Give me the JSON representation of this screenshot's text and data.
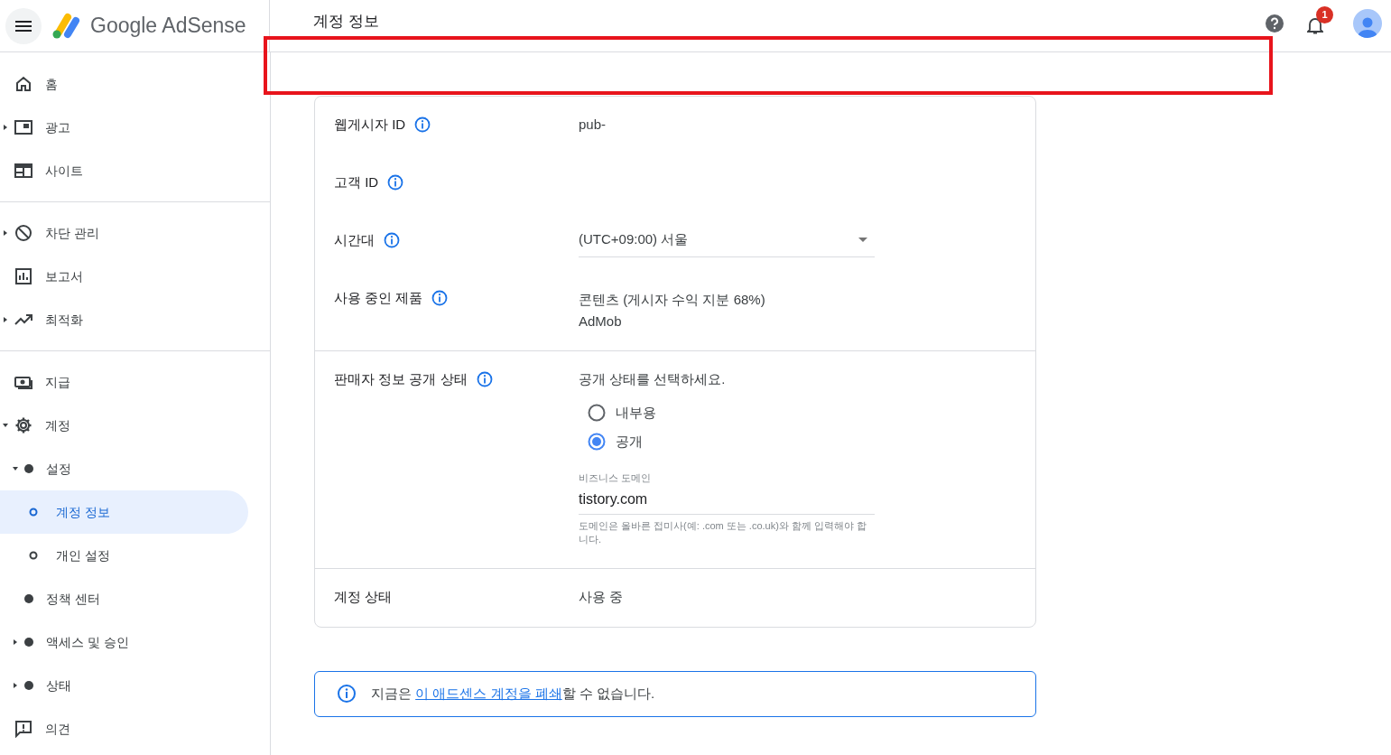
{
  "header": {
    "brand": "Google AdSense",
    "page_title": "계정 정보",
    "notification_count": "1"
  },
  "sidebar": {
    "sections": [
      [
        {
          "label": "홈",
          "selected": false
        },
        {
          "label": "광고",
          "expanded": false,
          "selected": false
        },
        {
          "label": "사이트",
          "selected": false
        }
      ],
      [
        {
          "label": "차단 관리",
          "expanded": false,
          "selected": false
        },
        {
          "label": "보고서",
          "selected": false
        },
        {
          "label": "최적화",
          "expanded": false,
          "selected": false
        }
      ],
      [
        {
          "label": "지급",
          "selected": false
        },
        {
          "label": "계정",
          "expanded": true,
          "selected": false,
          "children": [
            {
              "label": "설정",
              "expanded": true,
              "selected": false,
              "children": [
                {
                  "label": "계정 정보",
                  "selected": true
                },
                {
                  "label": "개인 설정",
                  "selected": false
                }
              ]
            },
            {
              "label": "정책 센터",
              "selected": false
            },
            {
              "label": "액세스 및 승인",
              "expanded": false,
              "selected": false
            },
            {
              "label": "상태",
              "expanded": false,
              "selected": false
            }
          ]
        },
        {
          "label": "의견",
          "selected": false
        }
      ]
    ]
  },
  "card": {
    "sections": [
      {
        "rows": [
          {
            "kind": "text",
            "label": "웹게시자 ID",
            "info": true,
            "value": "pub-"
          },
          {
            "kind": "text",
            "label": "고객 ID",
            "info": true
          },
          {
            "kind": "select",
            "label": "시간대",
            "info": true,
            "value": "(UTC+09:00) 서울"
          },
          {
            "kind": "lines",
            "label": "사용 중인 제품",
            "info": true,
            "lines": [
              "콘텐츠 (게시자 수익 지분 68%)",
              "AdMob"
            ]
          }
        ]
      },
      {
        "rows": [
          {
            "kind": "visibility",
            "label": "판매자 정보 공개 상태",
            "info": true,
            "prompt": "공개 상태를 선택하세요.",
            "options": [
              {
                "label": "내부용",
                "selected": false
              },
              {
                "label": "공개",
                "selected": true
              }
            ],
            "domain_field": {
              "label": "비즈니스 도메인",
              "value": "tistory.com",
              "hint": "도메인은 올바른 접미사(예: .com 또는 .co.uk)와 함께 입력해야 합니다."
            }
          }
        ]
      },
      {
        "rows": [
          {
            "kind": "text",
            "label": "계정 상태",
            "info": false,
            "value": "사용 중"
          }
        ]
      }
    ]
  },
  "notice": {
    "before": "지금은 ",
    "link": "이 애드센스 계정을 폐쇄",
    "after": "할 수 없습니다."
  }
}
